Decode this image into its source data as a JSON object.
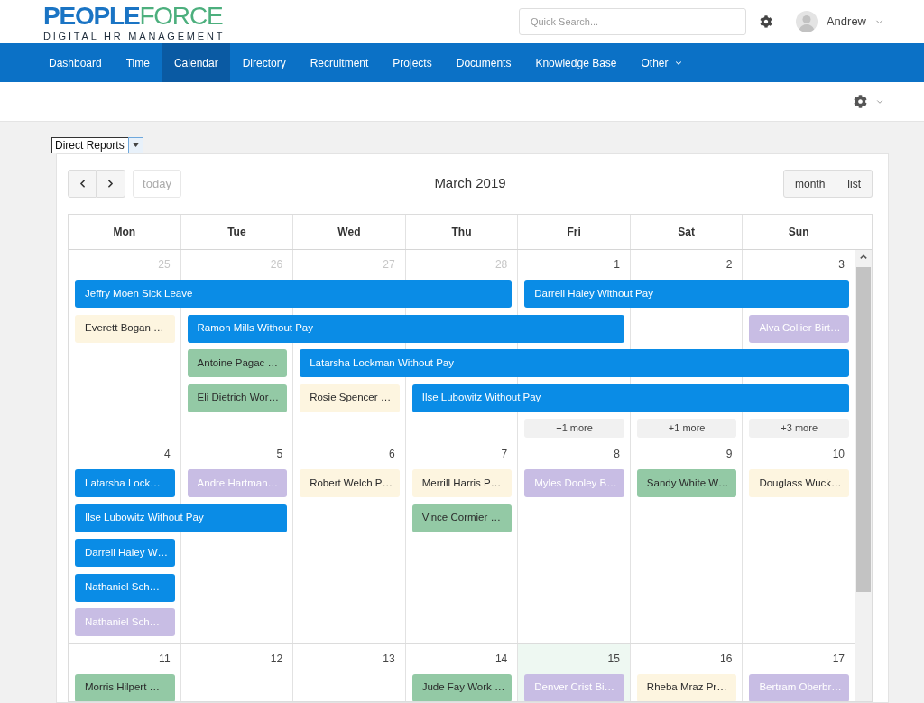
{
  "header": {
    "brand_primary": "PEOPLE",
    "brand_secondary": "FORCE",
    "tagline": "DIGITAL HR MANAGEMENT",
    "search": {
      "placeholder": "Quick Search..."
    },
    "user": {
      "name": "Andrew"
    }
  },
  "nav": [
    {
      "label": "Dashboard",
      "selected": false,
      "has_menu": false
    },
    {
      "label": "Time",
      "selected": false,
      "has_menu": false
    },
    {
      "label": "Calendar",
      "selected": true,
      "has_menu": false
    },
    {
      "label": "Directory",
      "selected": false,
      "has_menu": false
    },
    {
      "label": "Recruitment",
      "selected": false,
      "has_menu": false
    },
    {
      "label": "Projects",
      "selected": false,
      "has_menu": false
    },
    {
      "label": "Documents",
      "selected": false,
      "has_menu": false
    },
    {
      "label": "Knowledge Base",
      "selected": false,
      "has_menu": false
    },
    {
      "label": "Other",
      "selected": false,
      "has_menu": true
    }
  ],
  "filter": {
    "value": "Direct Reports"
  },
  "calendar": {
    "title": "March 2019",
    "today_button": {
      "label": "today",
      "disabled": true
    },
    "views": [
      {
        "label": "month"
      },
      {
        "label": "list"
      }
    ],
    "weekdays": [
      "Mon",
      "Tue",
      "Wed",
      "Thu",
      "Fri",
      "Sat",
      "Sun"
    ],
    "weeks": [
      {
        "days": [
          {
            "number": "25",
            "other_month": true,
            "today": false
          },
          {
            "number": "26",
            "other_month": true,
            "today": false
          },
          {
            "number": "27",
            "other_month": true,
            "today": false
          },
          {
            "number": "28",
            "other_month": true,
            "today": false
          },
          {
            "number": "1",
            "other_month": false,
            "today": false
          },
          {
            "number": "2",
            "other_month": false,
            "today": false
          },
          {
            "number": "3",
            "other_month": false,
            "today": false
          }
        ],
        "rows": [
          [
            {
              "kind": "event",
              "title": "Jeffry Moen Sick Leave",
              "color": "#0a8ce6"
            },
            {
              "kind": "continued"
            },
            {
              "kind": "continued"
            },
            {
              "kind": "continued"
            },
            {
              "kind": "event",
              "title": "Darrell Haley Without Pay",
              "color": "#0a8ce6"
            },
            {
              "kind": "continued"
            },
            {
              "kind": "continued"
            }
          ],
          [
            {
              "kind": "event",
              "title": "Everett Bogan …",
              "color": "#fdf5e0"
            },
            {
              "kind": "event",
              "title": "Ramon Mills Without Pay",
              "color": "#0a8ce6"
            },
            {
              "kind": "continued"
            },
            {
              "kind": "continued"
            },
            {
              "kind": "continued"
            },
            {
              "kind": "empty"
            },
            {
              "kind": "event",
              "title": "Alva Collier Birt…",
              "color": "#c8bde4"
            }
          ],
          [
            {
              "kind": "empty"
            },
            {
              "kind": "event",
              "title": "Antoine Pagac …",
              "color": "#93c9a5"
            },
            {
              "kind": "event",
              "title": "Latarsha Lockman Without Pay",
              "color": "#0a8ce6"
            },
            {
              "kind": "continued"
            },
            {
              "kind": "continued"
            },
            {
              "kind": "continued"
            },
            {
              "kind": "continued"
            }
          ],
          [
            {
              "kind": "empty"
            },
            {
              "kind": "event",
              "title": "Eli Dietrich Wor…",
              "color": "#93c9a5"
            },
            {
              "kind": "event",
              "title": "Rosie Spencer …",
              "color": "#fdf5e0"
            },
            {
              "kind": "event",
              "title": "Ilse Lubowitz Without Pay",
              "color": "#0a8ce6"
            },
            {
              "kind": "continued"
            },
            {
              "kind": "continued"
            },
            {
              "kind": "continued"
            }
          ],
          [
            {
              "kind": "empty"
            },
            {
              "kind": "empty"
            },
            {
              "kind": "empty"
            },
            {
              "kind": "empty"
            },
            {
              "kind": "more",
              "label": "+1 more"
            },
            {
              "kind": "more",
              "label": "+1 more"
            },
            {
              "kind": "more",
              "label": "+3 more"
            }
          ]
        ]
      },
      {
        "days": [
          {
            "number": "4",
            "other_month": false,
            "today": false
          },
          {
            "number": "5",
            "other_month": false,
            "today": false
          },
          {
            "number": "6",
            "other_month": false,
            "today": false
          },
          {
            "number": "7",
            "other_month": false,
            "today": false
          },
          {
            "number": "8",
            "other_month": false,
            "today": false
          },
          {
            "number": "9",
            "other_month": false,
            "today": false
          },
          {
            "number": "10",
            "other_month": false,
            "today": false
          }
        ],
        "rows": [
          [
            {
              "kind": "event",
              "title": "Latarsha Lock…",
              "color": "#0a8ce6"
            },
            {
              "kind": "event",
              "title": "Andre Hartman…",
              "color": "#c8bde4"
            },
            {
              "kind": "event",
              "title": "Robert Welch P…",
              "color": "#fdf5e0"
            },
            {
              "kind": "event",
              "title": "Merrill Harris P…",
              "color": "#fdf5e0"
            },
            {
              "kind": "event",
              "title": "Myles Dooley B…",
              "color": "#c8bde4"
            },
            {
              "kind": "event",
              "title": "Sandy White W…",
              "color": "#93c9a5"
            },
            {
              "kind": "event",
              "title": "Douglass Wuck…",
              "color": "#fdf5e0"
            }
          ],
          [
            {
              "kind": "event",
              "title": "Ilse Lubowitz Without Pay",
              "color": "#0a8ce6"
            },
            {
              "kind": "continued"
            },
            {
              "kind": "empty"
            },
            {
              "kind": "event",
              "title": "Vince Cormier …",
              "color": "#93c9a5"
            },
            {
              "kind": "empty"
            },
            {
              "kind": "empty"
            },
            {
              "kind": "empty"
            }
          ],
          [
            {
              "kind": "event",
              "title": "Darrell Haley W…",
              "color": "#0a8ce6"
            },
            {
              "kind": "empty"
            },
            {
              "kind": "empty"
            },
            {
              "kind": "empty"
            },
            {
              "kind": "empty"
            },
            {
              "kind": "empty"
            },
            {
              "kind": "empty"
            }
          ],
          [
            {
              "kind": "event",
              "title": "Nathaniel Sch…",
              "color": "#0a8ce6"
            },
            {
              "kind": "empty"
            },
            {
              "kind": "empty"
            },
            {
              "kind": "empty"
            },
            {
              "kind": "empty"
            },
            {
              "kind": "empty"
            },
            {
              "kind": "empty"
            }
          ],
          [
            {
              "kind": "event",
              "title": "Nathaniel Sch…",
              "color": "#c8bde4"
            },
            {
              "kind": "empty"
            },
            {
              "kind": "empty"
            },
            {
              "kind": "empty"
            },
            {
              "kind": "empty"
            },
            {
              "kind": "empty"
            },
            {
              "kind": "empty"
            }
          ]
        ]
      },
      {
        "days": [
          {
            "number": "11",
            "other_month": false,
            "today": false
          },
          {
            "number": "12",
            "other_month": false,
            "today": false
          },
          {
            "number": "13",
            "other_month": false,
            "today": false
          },
          {
            "number": "14",
            "other_month": false,
            "today": false
          },
          {
            "number": "15",
            "other_month": false,
            "today": true
          },
          {
            "number": "16",
            "other_month": false,
            "today": false
          },
          {
            "number": "17",
            "other_month": false,
            "today": false
          }
        ],
        "rows": [
          [
            {
              "kind": "event",
              "title": "Morris Hilpert …",
              "color": "#93c9a5"
            },
            {
              "kind": "empty"
            },
            {
              "kind": "empty"
            },
            {
              "kind": "event",
              "title": "Jude Fay Work …",
              "color": "#93c9a5"
            },
            {
              "kind": "event",
              "title": "Denver Crist Bi…",
              "color": "#c8bde4"
            },
            {
              "kind": "event",
              "title": "Rheba Mraz Pr…",
              "color": "#fdf5e0"
            },
            {
              "kind": "event",
              "title": "Bertram Oberbr…",
              "color": "#c8bde4"
            }
          ]
        ]
      }
    ]
  }
}
